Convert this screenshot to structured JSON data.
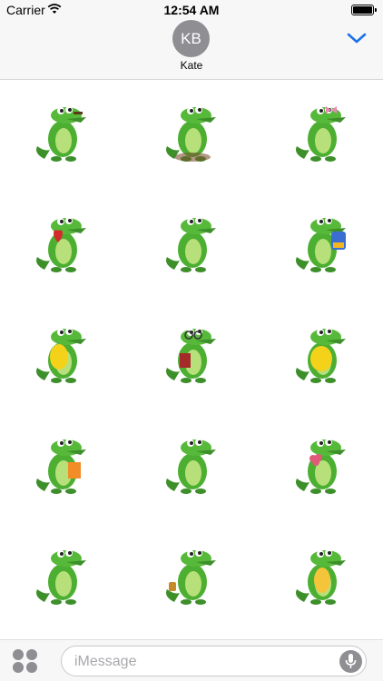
{
  "status_bar": {
    "carrier": "Carrier",
    "time": "12:54 AM",
    "wifi_icon": "wifi-icon",
    "battery_icon": "battery-icon",
    "battery_level": 1.0
  },
  "header": {
    "avatar_initials": "KB",
    "contact_name": "Kate",
    "collapse_icon": "chevron-down-icon",
    "accent_color": "#1a73e8"
  },
  "stickers": [
    {
      "name": "crocodile-sticker-pointing"
    },
    {
      "name": "crocodile-sticker-sitting"
    },
    {
      "name": "crocodile-sticker-bow"
    },
    {
      "name": "crocodile-sticker-hearts"
    },
    {
      "name": "crocodile-sticker-running"
    },
    {
      "name": "crocodile-sticker-backpack"
    },
    {
      "name": "crocodile-sticker-surprised"
    },
    {
      "name": "crocodile-sticker-glasses-book"
    },
    {
      "name": "crocodile-sticker-yellow-belly"
    },
    {
      "name": "crocodile-sticker-orange-book"
    },
    {
      "name": "crocodile-sticker-dancing"
    },
    {
      "name": "crocodile-sticker-flower"
    },
    {
      "name": "crocodile-sticker-waving"
    },
    {
      "name": "crocodile-sticker-lantern"
    },
    {
      "name": "crocodile-sticker-standing"
    }
  ],
  "input_bar": {
    "placeholder": "iMessage",
    "apps_icon": "app-drawer-icon",
    "mic_icon": "microphone-icon"
  }
}
